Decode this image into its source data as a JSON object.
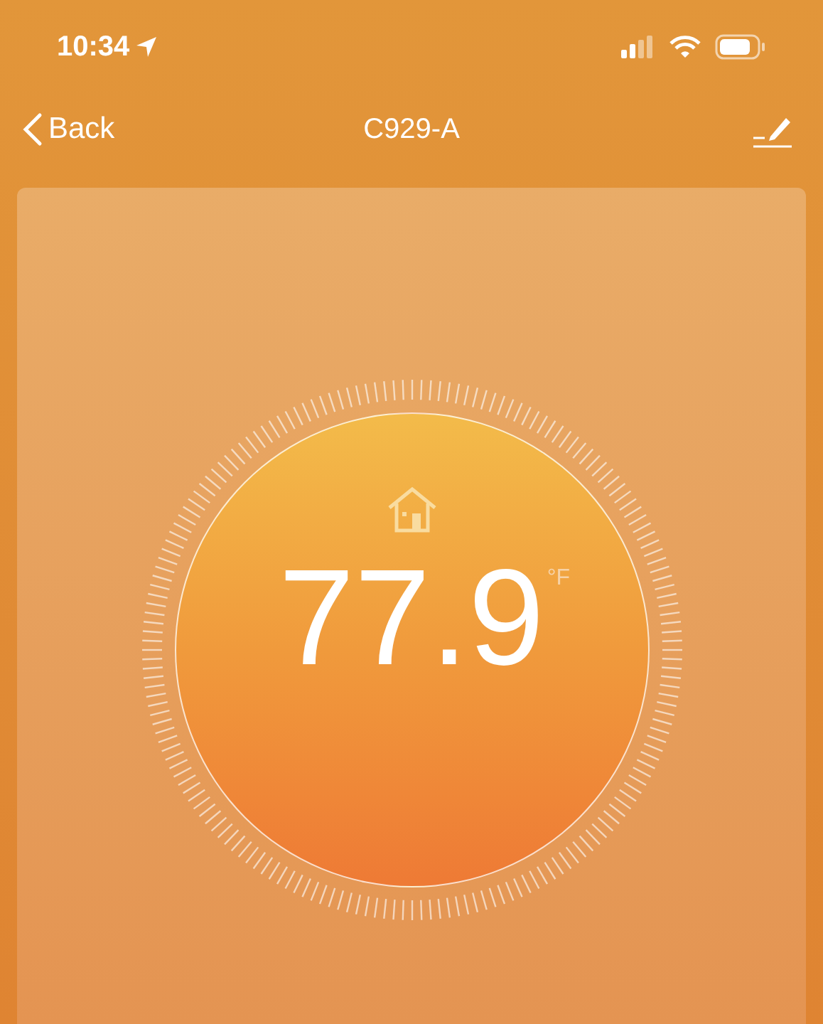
{
  "status_bar": {
    "time": "10:34"
  },
  "nav": {
    "back": "Back",
    "title": "C929-A"
  },
  "thermostat": {
    "temperature": "77.9",
    "unit": "°F"
  }
}
